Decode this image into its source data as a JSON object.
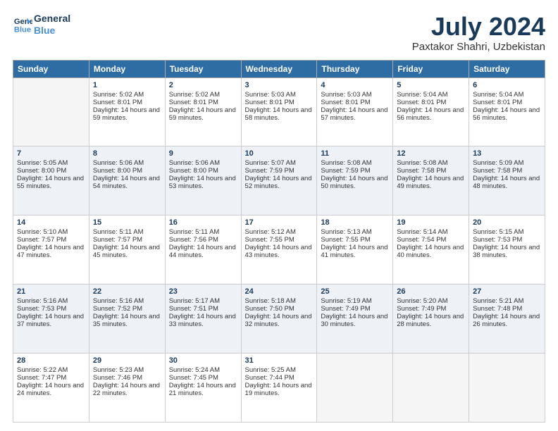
{
  "header": {
    "logo_line1": "General",
    "logo_line2": "Blue",
    "month": "July 2024",
    "location": "Paxtakor Shahri, Uzbekistan"
  },
  "days_of_week": [
    "Sunday",
    "Monday",
    "Tuesday",
    "Wednesday",
    "Thursday",
    "Friday",
    "Saturday"
  ],
  "weeks": [
    [
      {
        "day": "",
        "empty": true
      },
      {
        "day": "1",
        "sunrise": "5:02 AM",
        "sunset": "8:01 PM",
        "daylight": "14 hours and 59 minutes."
      },
      {
        "day": "2",
        "sunrise": "5:02 AM",
        "sunset": "8:01 PM",
        "daylight": "14 hours and 59 minutes."
      },
      {
        "day": "3",
        "sunrise": "5:03 AM",
        "sunset": "8:01 PM",
        "daylight": "14 hours and 58 minutes."
      },
      {
        "day": "4",
        "sunrise": "5:03 AM",
        "sunset": "8:01 PM",
        "daylight": "14 hours and 57 minutes."
      },
      {
        "day": "5",
        "sunrise": "5:04 AM",
        "sunset": "8:01 PM",
        "daylight": "14 hours and 56 minutes."
      },
      {
        "day": "6",
        "sunrise": "5:04 AM",
        "sunset": "8:01 PM",
        "daylight": "14 hours and 56 minutes."
      }
    ],
    [
      {
        "day": "7",
        "sunrise": "5:05 AM",
        "sunset": "8:00 PM",
        "daylight": "14 hours and 55 minutes."
      },
      {
        "day": "8",
        "sunrise": "5:06 AM",
        "sunset": "8:00 PM",
        "daylight": "14 hours and 54 minutes."
      },
      {
        "day": "9",
        "sunrise": "5:06 AM",
        "sunset": "8:00 PM",
        "daylight": "14 hours and 53 minutes."
      },
      {
        "day": "10",
        "sunrise": "5:07 AM",
        "sunset": "7:59 PM",
        "daylight": "14 hours and 52 minutes."
      },
      {
        "day": "11",
        "sunrise": "5:08 AM",
        "sunset": "7:59 PM",
        "daylight": "14 hours and 50 minutes."
      },
      {
        "day": "12",
        "sunrise": "5:08 AM",
        "sunset": "7:58 PM",
        "daylight": "14 hours and 49 minutes."
      },
      {
        "day": "13",
        "sunrise": "5:09 AM",
        "sunset": "7:58 PM",
        "daylight": "14 hours and 48 minutes."
      }
    ],
    [
      {
        "day": "14",
        "sunrise": "5:10 AM",
        "sunset": "7:57 PM",
        "daylight": "14 hours and 47 minutes."
      },
      {
        "day": "15",
        "sunrise": "5:11 AM",
        "sunset": "7:57 PM",
        "daylight": "14 hours and 45 minutes."
      },
      {
        "day": "16",
        "sunrise": "5:11 AM",
        "sunset": "7:56 PM",
        "daylight": "14 hours and 44 minutes."
      },
      {
        "day": "17",
        "sunrise": "5:12 AM",
        "sunset": "7:55 PM",
        "daylight": "14 hours and 43 minutes."
      },
      {
        "day": "18",
        "sunrise": "5:13 AM",
        "sunset": "7:55 PM",
        "daylight": "14 hours and 41 minutes."
      },
      {
        "day": "19",
        "sunrise": "5:14 AM",
        "sunset": "7:54 PM",
        "daylight": "14 hours and 40 minutes."
      },
      {
        "day": "20",
        "sunrise": "5:15 AM",
        "sunset": "7:53 PM",
        "daylight": "14 hours and 38 minutes."
      }
    ],
    [
      {
        "day": "21",
        "sunrise": "5:16 AM",
        "sunset": "7:53 PM",
        "daylight": "14 hours and 37 minutes."
      },
      {
        "day": "22",
        "sunrise": "5:16 AM",
        "sunset": "7:52 PM",
        "daylight": "14 hours and 35 minutes."
      },
      {
        "day": "23",
        "sunrise": "5:17 AM",
        "sunset": "7:51 PM",
        "daylight": "14 hours and 33 minutes."
      },
      {
        "day": "24",
        "sunrise": "5:18 AM",
        "sunset": "7:50 PM",
        "daylight": "14 hours and 32 minutes."
      },
      {
        "day": "25",
        "sunrise": "5:19 AM",
        "sunset": "7:49 PM",
        "daylight": "14 hours and 30 minutes."
      },
      {
        "day": "26",
        "sunrise": "5:20 AM",
        "sunset": "7:49 PM",
        "daylight": "14 hours and 28 minutes."
      },
      {
        "day": "27",
        "sunrise": "5:21 AM",
        "sunset": "7:48 PM",
        "daylight": "14 hours and 26 minutes."
      }
    ],
    [
      {
        "day": "28",
        "sunrise": "5:22 AM",
        "sunset": "7:47 PM",
        "daylight": "14 hours and 24 minutes."
      },
      {
        "day": "29",
        "sunrise": "5:23 AM",
        "sunset": "7:46 PM",
        "daylight": "14 hours and 22 minutes."
      },
      {
        "day": "30",
        "sunrise": "5:24 AM",
        "sunset": "7:45 PM",
        "daylight": "14 hours and 21 minutes."
      },
      {
        "day": "31",
        "sunrise": "5:25 AM",
        "sunset": "7:44 PM",
        "daylight": "14 hours and 19 minutes."
      },
      {
        "day": "",
        "empty": true
      },
      {
        "day": "",
        "empty": true
      },
      {
        "day": "",
        "empty": true
      }
    ]
  ]
}
